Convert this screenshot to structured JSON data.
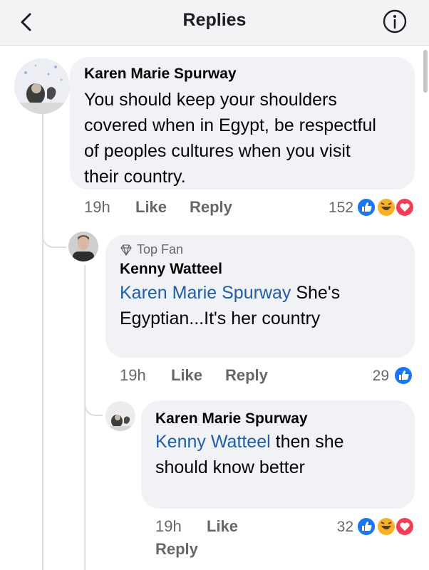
{
  "header": {
    "title": "Replies"
  },
  "comments": [
    {
      "author": "Karen Marie Spurway",
      "text": "You should keep your shoulders covered when in Egypt, be respectful of peoples cultures when you visit their country.",
      "line1": "You should keep your shoulders",
      "line2": "covered when in Egypt, be respectful",
      "line3": "of peoples cultures when you visit",
      "line4": "their country.",
      "time": "19h",
      "like": "Like",
      "reply": "Reply",
      "reaction_count": "152",
      "reactions": [
        "like-icon",
        "haha-icon",
        "love-icon"
      ]
    },
    {
      "badge": "Top Fan",
      "author": "Kenny Watteel",
      "mention": "Karen Marie Spurway",
      "line1_rest": " She's",
      "line2": "Egyptian...It's her country",
      "time": "19h",
      "like": "Like",
      "reply": "Reply",
      "reaction_count": "29",
      "reactions": [
        "like-icon"
      ]
    },
    {
      "author": "Karen Marie Spurway",
      "mention": "Kenny Watteel",
      "line1_rest": " then she",
      "line2": "should know better",
      "time": "19h",
      "like": "Like",
      "reply": "Reply",
      "reaction_count": "32",
      "reactions": [
        "like-icon",
        "haha-icon",
        "love-icon"
      ]
    }
  ],
  "colors": {
    "like": "#1877f2",
    "haha": "#f7b125",
    "love": "#f33e58",
    "mention": "#1f5ea8"
  }
}
